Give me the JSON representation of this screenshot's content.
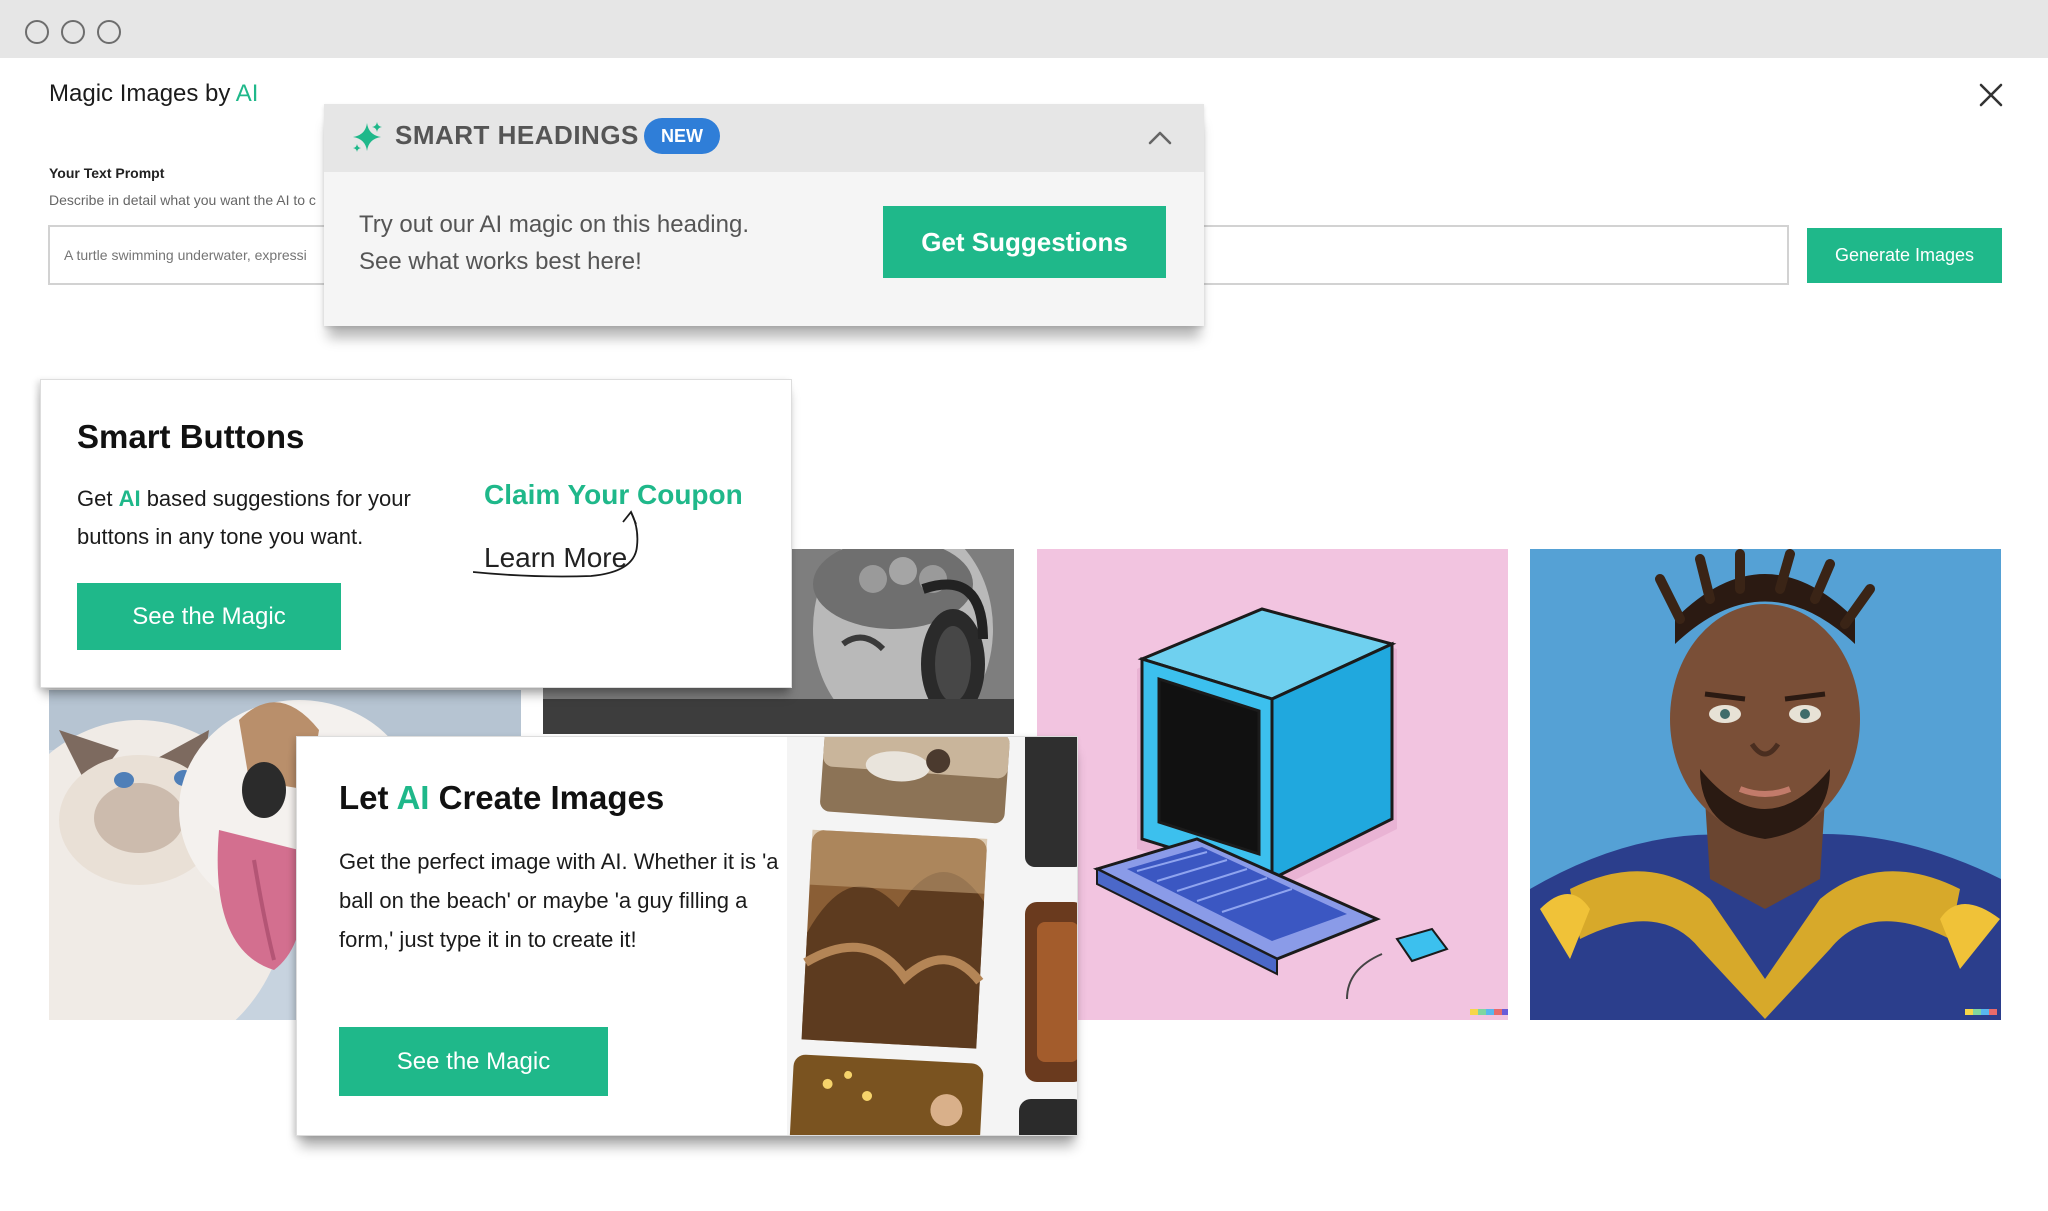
{
  "window": {
    "title_prefix": "Magic Images by ",
    "title_ai": "AI"
  },
  "prompt": {
    "label": "Your Text Prompt",
    "description": "Describe in detail what you want the AI to c",
    "placeholder": "A turtle swimming underwater, expressi",
    "generate_label": "Generate Images"
  },
  "smart_headings": {
    "title": "SMART HEADINGS",
    "badge": "NEW",
    "line1": "Try out our AI magic on this heading.",
    "line2": "See what works best here!",
    "button_label": "Get Suggestions"
  },
  "smart_buttons": {
    "title": "Smart Buttons",
    "text_before": "Get ",
    "text_ai": "AI",
    "text_after": " based suggestions for your buttons in any tone you want.",
    "example_primary": "Claim Your Coupon",
    "example_secondary": "Learn More",
    "button_label": "See the Magic"
  },
  "create_images": {
    "title_before": "Let ",
    "title_ai": "AI",
    "title_after": " Create Images",
    "description": "Get the perfect image with AI. Whether it is 'a ball on the beach' or maybe 'a guy filling a form,' just type it in to create it!",
    "button_label": "See the Magic"
  },
  "gallery": [
    {
      "name": "cat-and-dog-image"
    },
    {
      "name": "statue-headphones-image"
    },
    {
      "name": "retro-computer-image"
    },
    {
      "name": "football-player-painting-image"
    }
  ],
  "colors": {
    "accent": "#1fb88a",
    "badge": "#2f7ed8",
    "titlebar": "#e6e6e6",
    "computer_bg": "#f2c4e0",
    "painting_bg": "#2e86c9"
  }
}
